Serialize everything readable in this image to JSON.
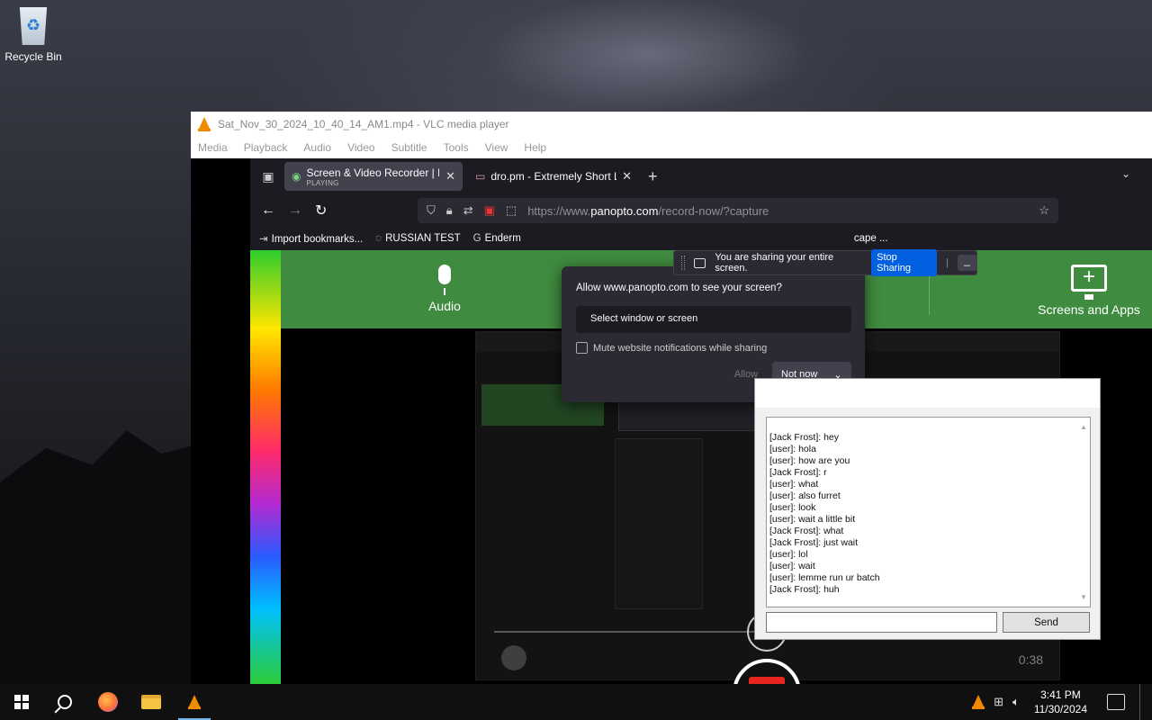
{
  "desktop": {
    "recycle_bin_label": "Recycle Bin"
  },
  "vlc": {
    "title": "Sat_Nov_30_2024_10_40_14_AM1.mp4 - VLC media player",
    "menu": [
      "Media",
      "Playback",
      "Audio",
      "Video",
      "Subtitle",
      "Tools",
      "View",
      "Help"
    ]
  },
  "firefox": {
    "tabs": [
      {
        "title": "Screen & Video Recorder | Panopto",
        "subtitle": "PLAYING",
        "active": true
      },
      {
        "title": "dro.pm - Extremely Short Links",
        "subtitle": "",
        "active": false
      }
    ],
    "url": {
      "prefix": "https://www.",
      "domain": "panopto.com",
      "path": "/record-now/?capture"
    },
    "bookmarks": [
      "Import bookmarks...",
      "RUSSIAN TEST",
      "Enderm",
      "cape ..."
    ]
  },
  "page": {
    "audio_label": "Audio",
    "screens_label": "Screens and Apps",
    "nested_time": "0:38"
  },
  "permission_dialog": {
    "title": "Allow www.panopto.com to see your screen?",
    "select_placeholder": "Select window or screen",
    "mute_label": "Mute website notifications while sharing",
    "allow_label": "Allow",
    "not_now_label": "Not now"
  },
  "sharing_bar": {
    "message": "You are sharing your entire screen.",
    "stop_label": "Stop Sharing",
    "min_label": "_"
  },
  "chat": {
    "messages": [
      "[Jack Frost]: hey",
      "[user]: hola",
      "[user]: how are you",
      "[Jack Frost]: r",
      "[user]: what",
      "[user]: also furret",
      "[user]: look",
      "[user]: wait a little bit",
      "[Jack Frost]: what",
      "[Jack Frost]: just wait",
      "[user]: lol",
      "[user]: wait",
      "[user]: lemme run ur batch",
      "[Jack Frost]: huh"
    ],
    "input_value": "",
    "send_label": "Send"
  },
  "taskbar": {
    "time": "3:41 PM",
    "date": "11/30/2024"
  },
  "colors": {
    "panopto_green": "#3f8b3f",
    "stop_sharing_blue": "#0060df",
    "record_red": "#e8251e",
    "vlc_orange": "#f08a00"
  }
}
